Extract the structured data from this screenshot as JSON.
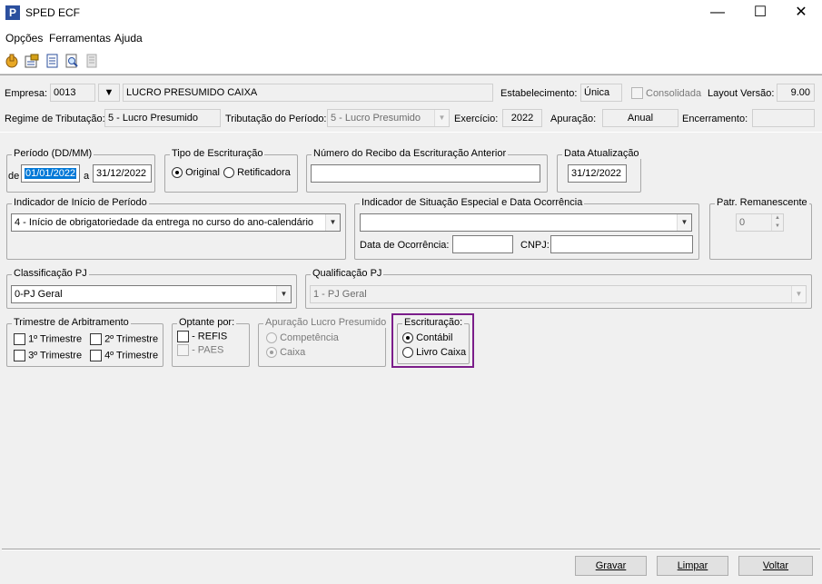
{
  "window": {
    "title": "SPED ECF",
    "icon_letter": "P",
    "minimize": "—",
    "maximize": "☐",
    "close": "✕"
  },
  "menu": [
    "Opções",
    "Ferramentas",
    "Ajuda"
  ],
  "header": {
    "empresa_label": "Empresa:",
    "empresa_code": "0013",
    "empresa_name": "LUCRO PRESUMIDO CAIXA",
    "estabelecimento_label": "Estabelecimento:",
    "estabelecimento_value": "Única",
    "consolidada_label": "Consolidada",
    "layout_label": "Layout Versão:",
    "layout_value": "9.00",
    "regime_label": "Regime de Tributação:",
    "regime_value": "5 - Lucro Presumido",
    "tributacao_label": "Tributação do Período:",
    "tributacao_value": "5 - Lucro Presumido",
    "exercicio_label": "Exercício:",
    "exercicio_value": "2022",
    "apuracao_label": "Apuração:",
    "apuracao_value": "Anual",
    "encerramento_label": "Encerramento:",
    "encerramento_value": ""
  },
  "periodo": {
    "title": "Período (DD/MM)",
    "de_label": "de",
    "de_value": "01/01/2022",
    "a_label": "a",
    "a_value": "31/12/2022"
  },
  "tipo_escrituracao": {
    "title": "Tipo de Escrituração",
    "original": "Original",
    "retificadora": "Retificadora"
  },
  "recibo": {
    "title": "Número do Recibo da Escrituração Anterior",
    "value": ""
  },
  "data_atualizacao": {
    "title": "Data Atualização",
    "value": "31/12/2022"
  },
  "inicio_periodo": {
    "title": "Indicador de Início de Período",
    "value": "4 - Início de obrigatoriedade da entrega no curso do ano-calendário"
  },
  "situacao_especial": {
    "title": "Indicador de Situação Especial e Data Ocorrência",
    "value": "",
    "data_label": "Data de Ocorrência:",
    "data_value": "",
    "cnpj_label": "CNPJ:",
    "cnpj_value": ""
  },
  "patr_remanescente": {
    "title": "Patr. Remanescente",
    "value": "0"
  },
  "classificacao": {
    "title": "Classificação PJ",
    "value": "0-PJ Geral"
  },
  "qualificacao": {
    "title": "Qualificação PJ",
    "value": "1 - PJ Geral"
  },
  "trimestre": {
    "title": "Trimestre de Arbitramento",
    "t1": "1º Trimestre",
    "t2": "2º Trimestre",
    "t3": "3º Trimestre",
    "t4": "4º Trimestre"
  },
  "optante": {
    "title": "Optante por:",
    "refis": "- REFIS",
    "paes": "- PAES"
  },
  "apuracao_lucro": {
    "title": "Apuração Lucro Presumido",
    "competencia": "Competência",
    "caixa": "Caixa"
  },
  "escrituracao": {
    "title": "Escrituração:",
    "contabil": "Contábil",
    "livro_caixa": "Livro Caixa"
  },
  "buttons": {
    "gravar": "Gravar",
    "limpar": "Limpar",
    "voltar": "Voltar"
  },
  "colors": {
    "highlight": "#7b1d8a",
    "selection": "#0078d7"
  }
}
